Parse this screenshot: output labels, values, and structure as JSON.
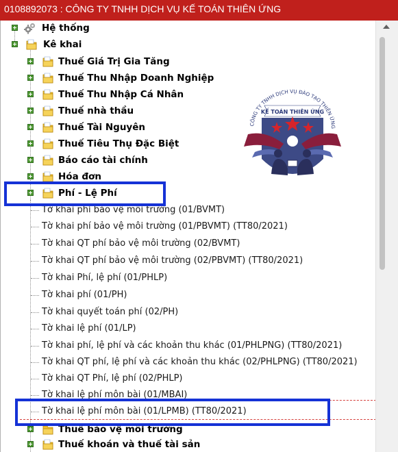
{
  "window": {
    "title": "0108892073 : CÔNG TY TNHH DỊCH VỤ KẾ TOÁN THIÊN ỨNG"
  },
  "tree": {
    "root_items": [
      {
        "label": "Hệ thống",
        "icon": "gear-icon"
      },
      {
        "label": "Kê khai",
        "icon": "folder-icon"
      }
    ],
    "kekhai_children": [
      {
        "label": "Thuế Giá Trị Gia Tăng"
      },
      {
        "label": "Thuế Thu Nhập Doanh Nghiệp"
      },
      {
        "label": "Thuế Thu Nhập Cá Nhân"
      },
      {
        "label": "Thuế nhà thầu"
      },
      {
        "label": "Thuế Tài Nguyên"
      },
      {
        "label": "Thuế Tiêu Thụ Đặc Biệt"
      },
      {
        "label": "Báo cáo tài chính"
      },
      {
        "label": "Hóa đơn"
      },
      {
        "label": "Phí - Lệ Phí"
      }
    ],
    "phi_le_phi_children": [
      "Tờ khai phí bảo vệ môi trường (01/BVMT)",
      "Tờ khai phí bảo vệ môi trường (01/PBVMT) (TT80/2021)",
      "Tờ khai QT phí bảo vệ môi trường (02/BVMT)",
      "Tờ khai QT phí bảo vệ môi trường (02/PBVMT) (TT80/2021)",
      "Tờ khai Phí, lệ phí (01/PHLP)",
      "Tờ khai phí (01/PH)",
      "Tờ khai quyết toán phí (02/PH)",
      "Tờ khai lệ phí (01/LP)",
      "Tờ khai phí, lệ phí và các khoản thu khác (01/PHLPNG) (TT80/2021)",
      "Tờ khai QT phí, lệ phí và các khoản thu khác (02/PHLPNG) (TT80/2021)",
      "Tờ khai QT Phí, lệ phí (02/PHLP)",
      "Tờ khai lệ phí môn bài (01/MBAI)",
      "Tờ khai lệ phí môn bài (01/LPMB) (TT80/2021)"
    ],
    "after_items": [
      {
        "label": "Thuế bảo vệ môi trường"
      },
      {
        "label": "Thuế khoán và thuế tài sản"
      }
    ]
  },
  "logo": {
    "arc_text": "CÔNG TY TNHH DỊCH VỤ ĐÀO TẠO THIÊN ỨNG",
    "ribbon_text": "KẾ TOÁN THIÊN ỨNG"
  },
  "colors": {
    "titlebar": "#c0201c",
    "highlight": "#1532d6",
    "expander": "#4f9a34",
    "folder": "#f2c12e",
    "selected_dash": "#d6403c"
  }
}
